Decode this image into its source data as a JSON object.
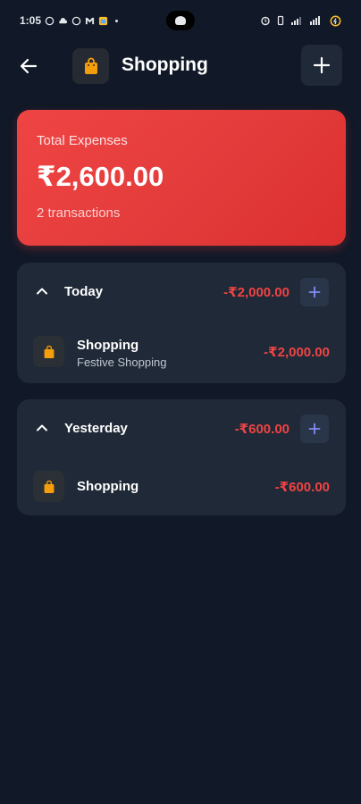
{
  "status_bar": {
    "time": "1:05",
    "left_icons": [
      "whatsapp-icon",
      "cloud-icon",
      "whatsapp-icon",
      "gmail-icon",
      "app-icon"
    ],
    "right_icons": [
      "alarm-icon",
      "vibrate-icon",
      "signal-icon",
      "wifi-icon",
      "battery-icon"
    ]
  },
  "header": {
    "title": "Shopping",
    "icon": "shopping-bag-icon"
  },
  "total_card": {
    "label": "Total Expenses",
    "amount": "₹2,600.00",
    "count": "2 transactions"
  },
  "groups": [
    {
      "title": "Today",
      "total": "-₹2,000.00",
      "transactions": [
        {
          "name": "Shopping",
          "note": "Festive Shopping",
          "amount": "-₹2,000.00"
        }
      ]
    },
    {
      "title": "Yesterday",
      "total": "-₹600.00",
      "transactions": [
        {
          "name": "Shopping",
          "note": "",
          "amount": "-₹600.00"
        }
      ]
    }
  ],
  "colors": {
    "background": "#111827",
    "card": "#1f2937",
    "accent_red": "#ef4444",
    "icon_orange": "#f59e0b",
    "plus_blue": "#818cf8"
  }
}
